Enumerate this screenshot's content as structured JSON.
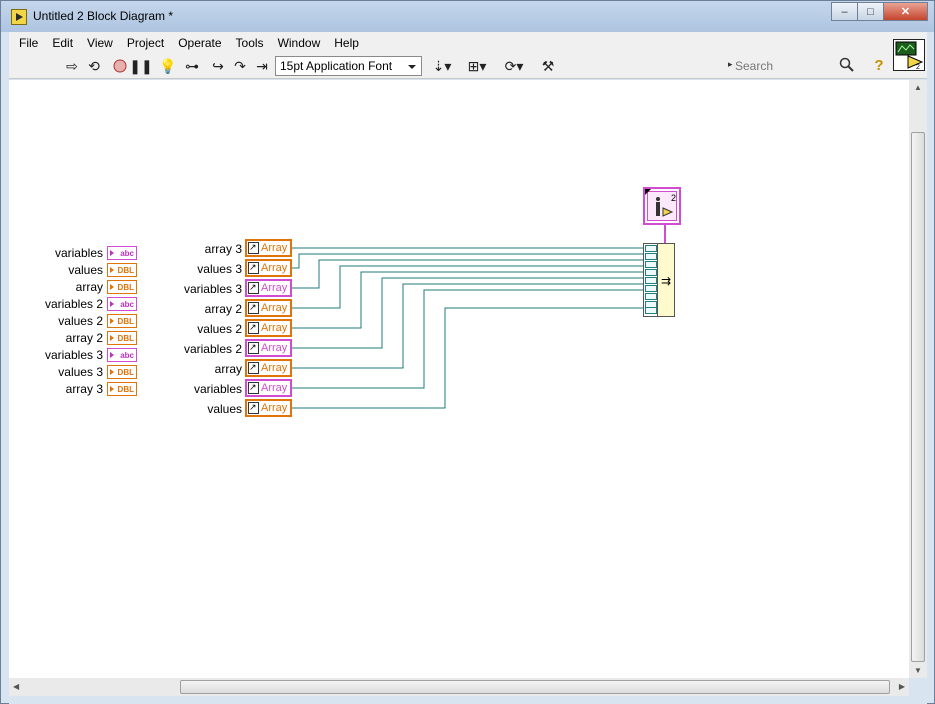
{
  "window": {
    "title": "Untitled 2 Block Diagram *",
    "minimize": "–",
    "maximize": "□",
    "close": "✕"
  },
  "menu": [
    "File",
    "Edit",
    "View",
    "Project",
    "Operate",
    "Tools",
    "Window",
    "Help"
  ],
  "toolbar": {
    "font": "15pt Application Font",
    "search_placeholder": "Search"
  },
  "connector_pane": {
    "number": "2"
  },
  "controls": [
    {
      "label": "variables",
      "type": "abc"
    },
    {
      "label": "values",
      "type": "DBL"
    },
    {
      "label": "array",
      "type": "DBL"
    },
    {
      "label": "variables 2",
      "type": "abc"
    },
    {
      "label": "values 2",
      "type": "DBL"
    },
    {
      "label": "array 2",
      "type": "DBL"
    },
    {
      "label": "variables 3",
      "type": "abc"
    },
    {
      "label": "values 3",
      "type": "DBL"
    },
    {
      "label": "array 3",
      "type": "DBL"
    }
  ],
  "array_nodes": [
    {
      "label": "array 3",
      "text": "Array",
      "kind": "num"
    },
    {
      "label": "values 3",
      "text": "Array",
      "kind": "num"
    },
    {
      "label": "variables 3",
      "text": "Array",
      "kind": "str"
    },
    {
      "label": "array 2",
      "text": "Array",
      "kind": "num"
    },
    {
      "label": "values 2",
      "text": "Array",
      "kind": "num"
    },
    {
      "label": "variables 2",
      "text": "Array",
      "kind": "str"
    },
    {
      "label": "array",
      "text": "Array",
      "kind": "num"
    },
    {
      "label": "variables",
      "text": "Array",
      "kind": "str"
    },
    {
      "label": "values",
      "text": "Array",
      "kind": "num"
    }
  ],
  "cluster_node": {
    "count": "2"
  },
  "colors": {
    "wire": "#1f7a7a",
    "numeric": "#e0730a",
    "string": "#d24cd2"
  }
}
